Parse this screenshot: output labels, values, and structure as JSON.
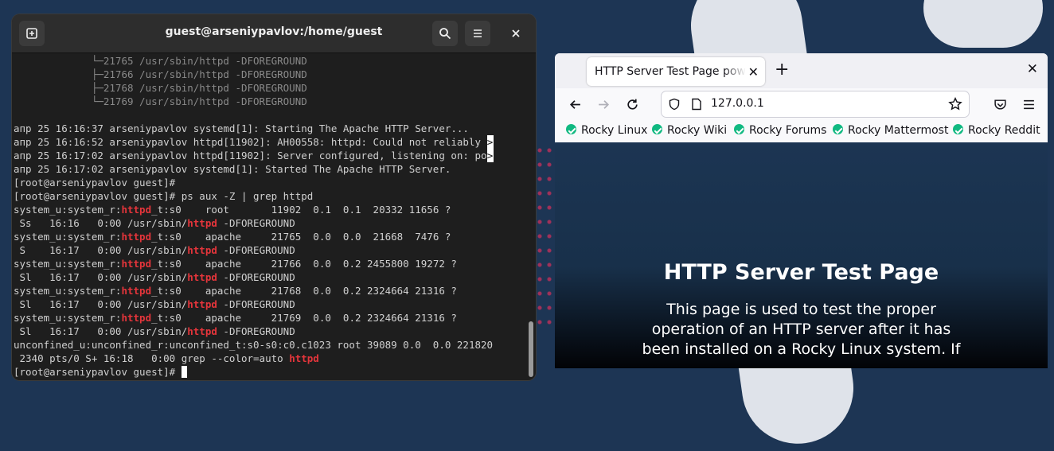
{
  "terminal": {
    "title": "guest@arseniypavlov:/home/guest",
    "lines": [
      [
        {
          "t": "             └─21765 /usr/sbin/httpd -DFOREGROUND",
          "c": "dim"
        }
      ],
      [
        {
          "t": "             ├─21766 /usr/sbin/httpd -DFOREGROUND",
          "c": "dim"
        }
      ],
      [
        {
          "t": "             ├─21768 /usr/sbin/httpd -DFOREGROUND",
          "c": "dim"
        }
      ],
      [
        {
          "t": "             └─21769 /usr/sbin/httpd -DFOREGROUND",
          "c": "dim"
        }
      ],
      [
        {
          "t": ""
        }
      ],
      [
        {
          "t": "апр 25 16:16:37 arseniypavlov systemd[1]: Starting The Apache HTTP Server..."
        }
      ],
      [
        {
          "t": "апр 25 16:16:52 arseniypavlov httpd[11902]: AH00558: httpd: Could not reliably "
        },
        {
          "t": ">",
          "c": "trunc"
        }
      ],
      [
        {
          "t": "апр 25 16:17:02 arseniypavlov httpd[11902]: Server configured, listening on: po"
        },
        {
          "t": ">",
          "c": "trunc"
        }
      ],
      [
        {
          "t": "апр 25 16:17:02 arseniypavlov systemd[1]: Started The Apache HTTP Server."
        }
      ],
      [
        {
          "t": "[root@arseniypavlov guest]#"
        }
      ],
      [
        {
          "t": "[root@arseniypavlov guest]# ps aux -Z | grep httpd"
        }
      ],
      [
        {
          "t": "system_u:system_r:"
        },
        {
          "t": "httpd",
          "c": "red"
        },
        {
          "t": "_t:s0    root       11902  0.1  0.1  20332 11656 ?"
        }
      ],
      [
        {
          "t": " Ss   16:16   0:00 /usr/sbin/"
        },
        {
          "t": "httpd",
          "c": "red"
        },
        {
          "t": " -DFOREGROUND"
        }
      ],
      [
        {
          "t": "system_u:system_r:"
        },
        {
          "t": "httpd",
          "c": "red"
        },
        {
          "t": "_t:s0    apache     21765  0.0  0.0  21668  7476 ?"
        }
      ],
      [
        {
          "t": " S    16:17   0:00 /usr/sbin/"
        },
        {
          "t": "httpd",
          "c": "red"
        },
        {
          "t": " -DFOREGROUND"
        }
      ],
      [
        {
          "t": "system_u:system_r:"
        },
        {
          "t": "httpd",
          "c": "red"
        },
        {
          "t": "_t:s0    apache     21766  0.0  0.2 2455800 19272 ?"
        }
      ],
      [
        {
          "t": " Sl   16:17   0:00 /usr/sbin/"
        },
        {
          "t": "httpd",
          "c": "red"
        },
        {
          "t": " -DFOREGROUND"
        }
      ],
      [
        {
          "t": "system_u:system_r:"
        },
        {
          "t": "httpd",
          "c": "red"
        },
        {
          "t": "_t:s0    apache     21768  0.0  0.2 2324664 21316 ?"
        }
      ],
      [
        {
          "t": " Sl   16:17   0:00 /usr/sbin/"
        },
        {
          "t": "httpd",
          "c": "red"
        },
        {
          "t": " -DFOREGROUND"
        }
      ],
      [
        {
          "t": "system_u:system_r:"
        },
        {
          "t": "httpd",
          "c": "red"
        },
        {
          "t": "_t:s0    apache     21769  0.0  0.2 2324664 21316 ?"
        }
      ],
      [
        {
          "t": " Sl   16:17   0:00 /usr/sbin/"
        },
        {
          "t": "httpd",
          "c": "red"
        },
        {
          "t": " -DFOREGROUND"
        }
      ],
      [
        {
          "t": "unconfined_u:unconfined_r:unconfined_t:s0-s0:c0.c1023 root 39089 0.0  0.0 221820"
        }
      ],
      [
        {
          "t": " 2340 pts/0 S+ 16:18   0:00 grep --color=auto "
        },
        {
          "t": "httpd",
          "c": "red"
        }
      ],
      [
        {
          "t": "[root@arseniypavlov guest]# "
        },
        {
          "t": "",
          "c": "cursor"
        }
      ]
    ]
  },
  "browser": {
    "tab_title": "HTTP Server Test Page powered by: Rocky Linux",
    "url": "127.0.0.1",
    "bookmarks": [
      "Rocky Linux",
      "Rocky Wiki",
      "Rocky Forums",
      "Rocky Mattermost",
      "Rocky Reddit"
    ],
    "page": {
      "heading_light": "HTTP Server ",
      "heading_bold": "Test Page",
      "paragraph": "This page is used to test the proper operation of an HTTP server after it has been installed on a Rocky Linux system. If"
    }
  }
}
